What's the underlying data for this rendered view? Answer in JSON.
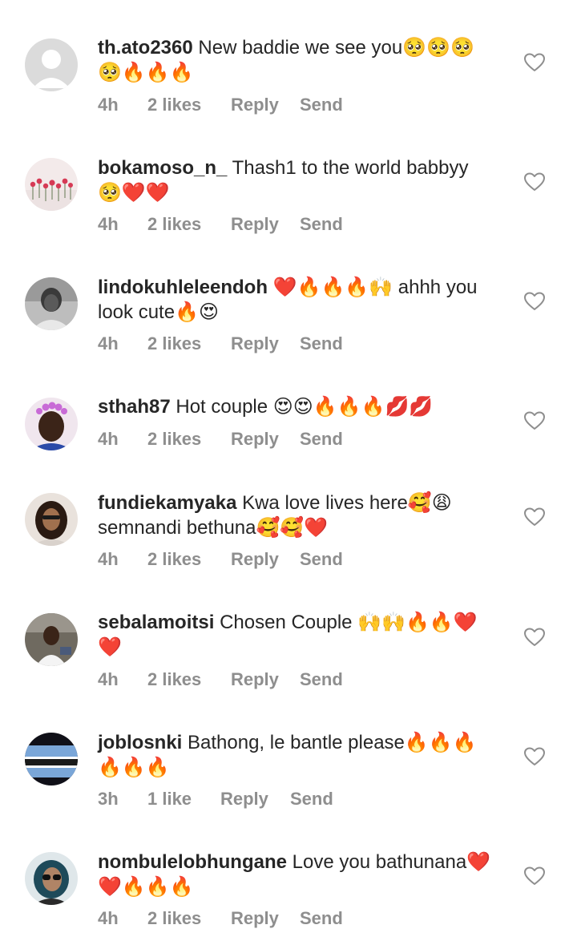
{
  "comments": [
    {
      "username": "th.ato2360",
      "line1": " New baddie we see you🥺🥺🥺",
      "line2": "🥺🔥🔥🔥",
      "time": "4h",
      "likes": "2 likes",
      "reply": "Reply",
      "send": "Send",
      "avatar": "default-avatar"
    },
    {
      "username": "bokamoso_n_",
      "line1": " Thash1 to the world babbyy",
      "line2": "🥺❤️❤️",
      "time": "4h",
      "likes": "2 likes",
      "reply": "Reply",
      "send": "Send",
      "avatar": "flowers-photo"
    },
    {
      "username": "lindokuhleleendoh",
      "line1": " ❤️🔥🔥🔥🙌 ahhh you",
      "line2": "look cute🔥😍",
      "time": "4h",
      "likes": "2 likes",
      "reply": "Reply",
      "send": "Send",
      "avatar": "bw-portrait-photo"
    },
    {
      "username": "sthah87",
      "line1": " Hot couple 😍😍🔥🔥🔥💋💋",
      "line2": "",
      "time": "4h",
      "likes": "2 likes",
      "reply": "Reply",
      "send": "Send",
      "avatar": "flower-crown-photo"
    },
    {
      "username": "fundiekamyaka",
      "line1": " Kwa love lives here🥰😩",
      "line2": "semnandi bethuna🥰🥰❤️",
      "time": "4h",
      "likes": "2 likes",
      "reply": "Reply",
      "send": "Send",
      "avatar": "portrait-photo"
    },
    {
      "username": "sebalamoitsi",
      "line1": " Chosen Couple 🙌🙌🔥🔥❤️",
      "line2": "❤️",
      "time": "4h",
      "likes": "2 likes",
      "reply": "Reply",
      "send": "Send",
      "avatar": "selfie-photo"
    },
    {
      "username": "joblosnki",
      "line1": " Bathong, le bantle please🔥🔥🔥",
      "line2": "🔥🔥🔥",
      "time": "3h",
      "likes": "1 like",
      "reply": "Reply",
      "send": "Send",
      "avatar": "flag-photo"
    },
    {
      "username": "nombulelobhungane",
      "line1": " Love you bathunana❤️",
      "line2": "❤️🔥🔥🔥",
      "time": "4h",
      "likes": "2 likes",
      "reply": "Reply",
      "send": "Send",
      "avatar": "sunglasses-photo"
    }
  ],
  "colors": {
    "text": "#262626",
    "meta": "#8e8e8e",
    "heart_outline": "#8e8e8e"
  }
}
